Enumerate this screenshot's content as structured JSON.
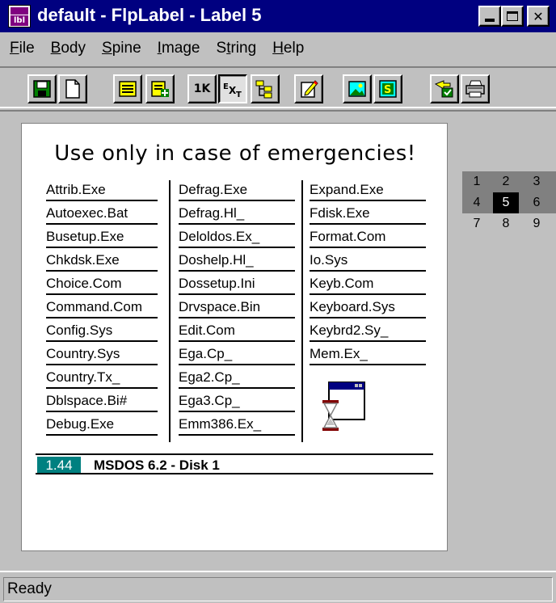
{
  "window": {
    "title": "default - FlpLabel - Label 5",
    "app_icon_text": "lbl"
  },
  "menu": [
    "File",
    "Body",
    "Spine",
    "Image",
    "String",
    "Help"
  ],
  "toolbar": {
    "buttons": [
      {
        "name": "save",
        "glyph": ""
      },
      {
        "name": "new",
        "glyph": ""
      },
      {
        "name": "list",
        "glyph": ""
      },
      {
        "name": "add",
        "glyph": ""
      },
      {
        "name": "1k",
        "glyph": "1K"
      },
      {
        "name": "ext",
        "glyph": "EXT"
      },
      {
        "name": "tree",
        "glyph": ""
      },
      {
        "name": "edit",
        "glyph": ""
      },
      {
        "name": "picture",
        "glyph": ""
      },
      {
        "name": "string",
        "glyph": "S"
      },
      {
        "name": "export",
        "glyph": ""
      },
      {
        "name": "print",
        "glyph": ""
      }
    ]
  },
  "label": {
    "title": "Use only in case of emergencies!",
    "columns": [
      [
        "Attrib.Exe",
        "Autoexec.Bat",
        "Busetup.Exe",
        "Chkdsk.Exe",
        "Choice.Com",
        "Command.Com",
        "Config.Sys",
        "Country.Sys",
        "Country.Tx_",
        "Dblspace.Bi#",
        "Debug.Exe"
      ],
      [
        "Defrag.Exe",
        "Defrag.Hl_",
        "Deloldos.Ex_",
        "Doshelp.Hl_",
        "Dossetup.Ini",
        "Drvspace.Bin",
        "Edit.Com",
        "Ega.Cp_",
        "Ega2.Cp_",
        "Ega3.Cp_",
        "Emm386.Ex_"
      ],
      [
        "Expand.Exe",
        "Fdisk.Exe",
        "Format.Com",
        "Io.Sys",
        "Keyb.Com",
        "Keyboard.Sys",
        "Keybrd2.Sy_",
        "Mem.Ex_"
      ]
    ],
    "disk_size": "1.44",
    "disk_title": "MSDOS 6.2 - Disk 1"
  },
  "label_grid": {
    "cells": [
      "1",
      "2",
      "3",
      "4",
      "5",
      "6",
      "7",
      "8",
      "9"
    ],
    "selected": "5"
  },
  "status": {
    "text": "Ready"
  },
  "colors": {
    "titlebar": "#000080",
    "disk_size_bg": "#008080",
    "window_bg": "#c0c0c0"
  }
}
